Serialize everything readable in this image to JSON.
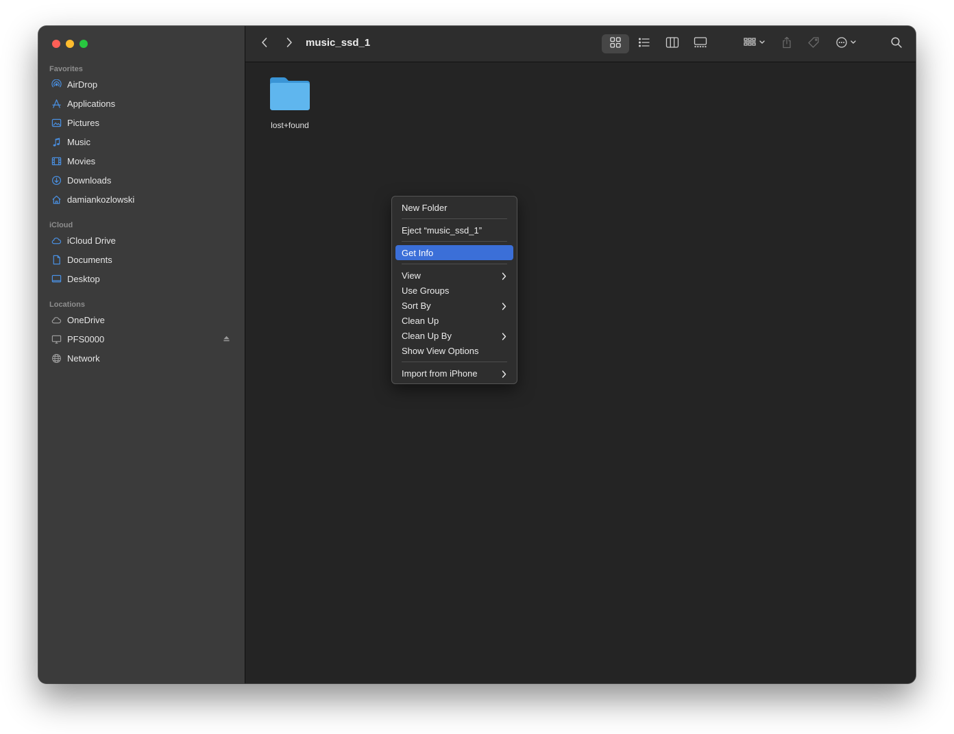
{
  "window": {
    "title": "music_ssd_1",
    "traffic_colors": [
      "#ff5f57",
      "#febc2e",
      "#28c840"
    ]
  },
  "sidebar": {
    "favorites_title": "Favorites",
    "favorites": [
      {
        "label": "AirDrop",
        "icon": "airdrop-icon"
      },
      {
        "label": "Applications",
        "icon": "applications-icon"
      },
      {
        "label": "Pictures",
        "icon": "pictures-icon"
      },
      {
        "label": "Music",
        "icon": "music-icon"
      },
      {
        "label": "Movies",
        "icon": "movies-icon"
      },
      {
        "label": "Downloads",
        "icon": "downloads-icon"
      },
      {
        "label": "damiankozlowski",
        "icon": "home-icon"
      }
    ],
    "icloud_title": "iCloud",
    "icloud": [
      {
        "label": "iCloud Drive",
        "icon": "cloud-icon"
      },
      {
        "label": "Documents",
        "icon": "document-icon"
      },
      {
        "label": "Desktop",
        "icon": "desktop-icon"
      }
    ],
    "locations_title": "Locations",
    "locations": [
      {
        "label": "OneDrive",
        "icon": "cloud-icon"
      },
      {
        "label": "PFS0000",
        "icon": "display-icon"
      },
      {
        "label": "Network",
        "icon": "network-icon"
      }
    ],
    "accent_color": "#4a90e2"
  },
  "toolbar": {
    "icons": [
      "back-icon",
      "forward-icon",
      "icon-view-icon",
      "list-view-icon",
      "column-view-icon",
      "gallery-view-icon",
      "group-icon",
      "share-icon",
      "tag-icon",
      "more-icon",
      "search-icon"
    ]
  },
  "content": {
    "items": [
      {
        "label": "lost+found",
        "icon": "folder-icon"
      }
    ]
  },
  "context_menu": {
    "new_folder": "New Folder",
    "eject": "Eject “music_ssd_1”",
    "get_info": "Get Info",
    "view": "View",
    "use_groups": "Use Groups",
    "sort_by": "Sort By",
    "clean_up": "Clean Up",
    "clean_up_by": "Clean Up By",
    "show_view_options": "Show View Options",
    "import_from_iphone": "Import from iPhone",
    "highlight_color": "#3b6fd8"
  }
}
